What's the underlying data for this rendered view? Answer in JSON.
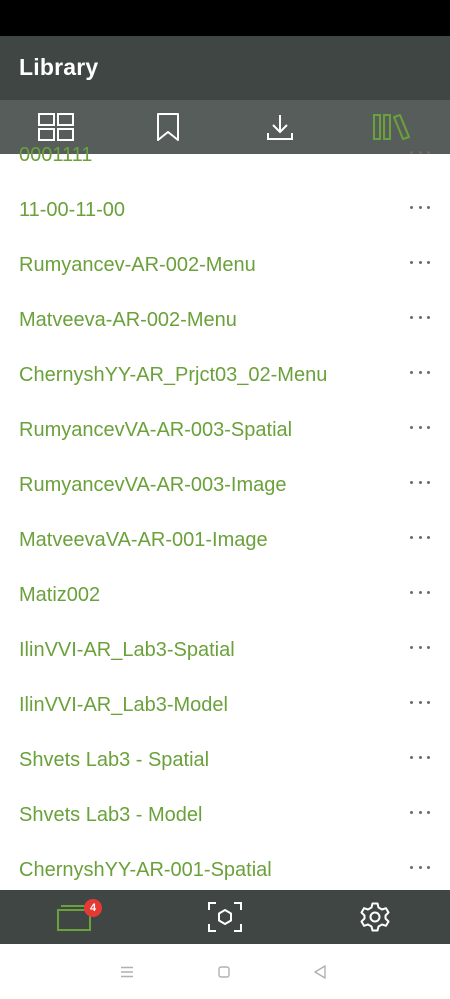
{
  "app": {
    "title": "Library"
  },
  "tabs": [
    {
      "name": "grid-icon",
      "active": false
    },
    {
      "name": "bookmark-icon",
      "active": false
    },
    {
      "name": "download-icon",
      "active": false
    },
    {
      "name": "library-icon",
      "active": true
    }
  ],
  "library": {
    "items": [
      {
        "label": "0001111"
      },
      {
        "label": "11-00-11-00"
      },
      {
        "label": "Rumyancev-AR-002-Menu"
      },
      {
        "label": "Matveeva-AR-002-Menu"
      },
      {
        "label": "ChernyshYY-AR_Prjct03_02-Menu"
      },
      {
        "label": "RumyancevVA-AR-003-Spatial"
      },
      {
        "label": "RumyancevVA-AR-003-Image"
      },
      {
        "label": "MatveevaVA-AR-001-Image"
      },
      {
        "label": "Matiz002"
      },
      {
        "label": "IlinVVI-AR_Lab3-Spatial"
      },
      {
        "label": "IlinVVI-AR_Lab3-Model"
      },
      {
        "label": "Shvets Lab3 - Spatial"
      },
      {
        "label": "Shvets Lab3 - Model"
      },
      {
        "label": "ChernyshYY-AR-001-Spatial"
      }
    ]
  },
  "bottom_nav": {
    "projects_badge": "4",
    "icons": [
      "projects-icon",
      "scan-icon",
      "settings-icon"
    ]
  },
  "system_nav": {
    "icons": [
      "menu-icon",
      "home-icon",
      "back-icon"
    ]
  },
  "colors": {
    "accent": "#6aa13a",
    "header_bg": "#3f4643",
    "tab_bg": "#565d5a",
    "badge": "#e53935"
  }
}
